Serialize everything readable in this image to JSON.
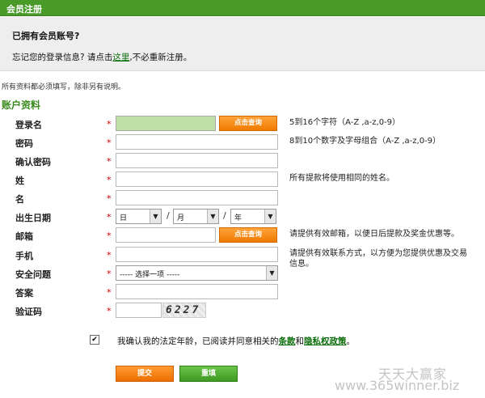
{
  "topbar": {
    "title": "会员注册"
  },
  "info": {
    "heading": "已拥有会员账号?",
    "line_prefix": "忘记您的登录信息? 请点击",
    "link": "这里",
    "line_suffix": ",不必重新注册。"
  },
  "note": "所有资料都必须填写，除非另有说明。",
  "section_title": "账户资料",
  "required_mark": "*",
  "fields": {
    "username": {
      "label": "登录名",
      "button": "点击查询",
      "hint": "5到16个字符（A-Z ,a-z,0-9）"
    },
    "password": {
      "label": "密码",
      "hint": "8到10个数字及字母组合（A-Z ,a-z,0-9）"
    },
    "confirm_password": {
      "label": "确认密码"
    },
    "last_name": {
      "label": "姓",
      "hint": "所有提款将使用相同的姓名。"
    },
    "first_name": {
      "label": "名"
    },
    "birthdate": {
      "label": "出生日期",
      "day": "日",
      "month": "月",
      "year": "年",
      "separator": "/"
    },
    "email": {
      "label": "邮箱",
      "button": "点击查询",
      "hint": "请提供有效邮箱，以便日后提款及奖金优惠等。"
    },
    "phone": {
      "label": "手机",
      "hint_line1": "请提供有效联系方式，以方便为您提供优惠及交易",
      "hint_line2": "信息。"
    },
    "security_question": {
      "label": "安全问题",
      "selected": "----- 选择一项 -----"
    },
    "answer": {
      "label": "答案"
    },
    "captcha": {
      "label": "验证码",
      "code": "6227"
    }
  },
  "agree": {
    "prefix": "我确认我的法定年龄，已阅读并同意相关的",
    "terms": "条款",
    "and": "和",
    "privacy": "隐私权政策",
    "suffix": "。",
    "checked": "✔"
  },
  "buttons": {
    "submit": "提交",
    "reset": "重填"
  },
  "watermark": {
    "line1": "天天大赢家",
    "line2": "www.365winner.biz"
  },
  "colors": {
    "brand_green": "#4a9a2a",
    "section_green": "#3a8a1e",
    "orange": "#f07a00",
    "required_red": "#d80000",
    "highlight_field": "#bde0a8"
  },
  "icons": {
    "dropdown": "chevron-down-icon",
    "checkbox": "checkmark-icon"
  }
}
